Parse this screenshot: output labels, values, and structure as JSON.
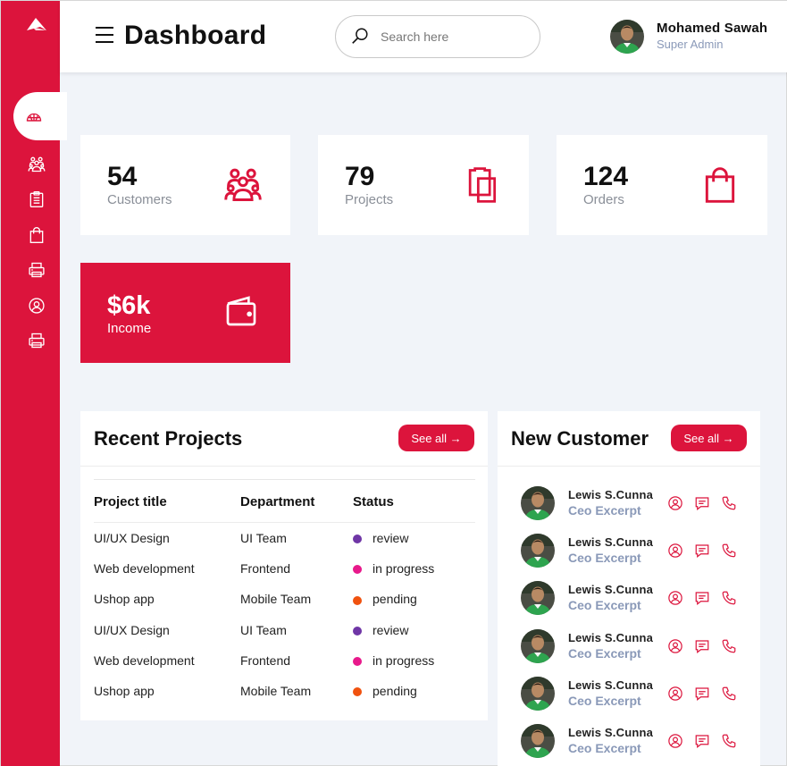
{
  "brand": {
    "color": "#dc143c"
  },
  "sidebar": {
    "items": [
      {
        "icon": "dashboard-icon",
        "active": true
      },
      {
        "icon": "customers-icon"
      },
      {
        "icon": "clipboard-icon"
      },
      {
        "icon": "bag-icon"
      },
      {
        "icon": "printer-icon"
      },
      {
        "icon": "user-circle-icon"
      },
      {
        "icon": "printer-icon"
      }
    ]
  },
  "header": {
    "title": "Dashboard",
    "search_placeholder": "Search here",
    "user_name": "Mohamed Sawah",
    "user_role": "Super Admin"
  },
  "stats": [
    {
      "value": "54",
      "label": "Customers",
      "icon": "customers-icon"
    },
    {
      "value": "79",
      "label": "Projects",
      "icon": "clipboard-icon"
    },
    {
      "value": "124",
      "label": "Orders",
      "icon": "bag-icon"
    },
    {
      "value": "$6k",
      "label": "Income",
      "icon": "wallet-icon"
    }
  ],
  "recent_projects": {
    "title": "Recent Projects",
    "see_all": "See all",
    "columns": [
      "Project title",
      "Department",
      "Status"
    ],
    "rows": [
      {
        "title": "UI/UX Design",
        "department": "UI Team",
        "status": "review",
        "color": "#6f36a6"
      },
      {
        "title": "Web development",
        "department": "Frontend",
        "status": "in progress",
        "color": "#e8198b"
      },
      {
        "title": "Ushop app",
        "department": "Mobile Team",
        "status": "pending",
        "color": "#f0520f"
      },
      {
        "title": "UI/UX Design",
        "department": "UI Team",
        "status": "review",
        "color": "#6f36a6"
      },
      {
        "title": "Web development",
        "department": "Frontend",
        "status": "in progress",
        "color": "#e8198b"
      },
      {
        "title": "Ushop app",
        "department": "Mobile Team",
        "status": "pending",
        "color": "#f0520f"
      }
    ]
  },
  "new_customers": {
    "title": "New Customer",
    "see_all": "See all",
    "rows": [
      {
        "name": "Lewis S.Cunna",
        "role": "Ceo Excerpt"
      },
      {
        "name": "Lewis S.Cunna",
        "role": "Ceo Excerpt"
      },
      {
        "name": "Lewis S.Cunna",
        "role": "Ceo Excerpt"
      },
      {
        "name": "Lewis S.Cunna",
        "role": "Ceo Excerpt"
      },
      {
        "name": "Lewis S.Cunna",
        "role": "Ceo Excerpt"
      },
      {
        "name": "Lewis S.Cunna",
        "role": "Ceo Excerpt"
      }
    ]
  }
}
